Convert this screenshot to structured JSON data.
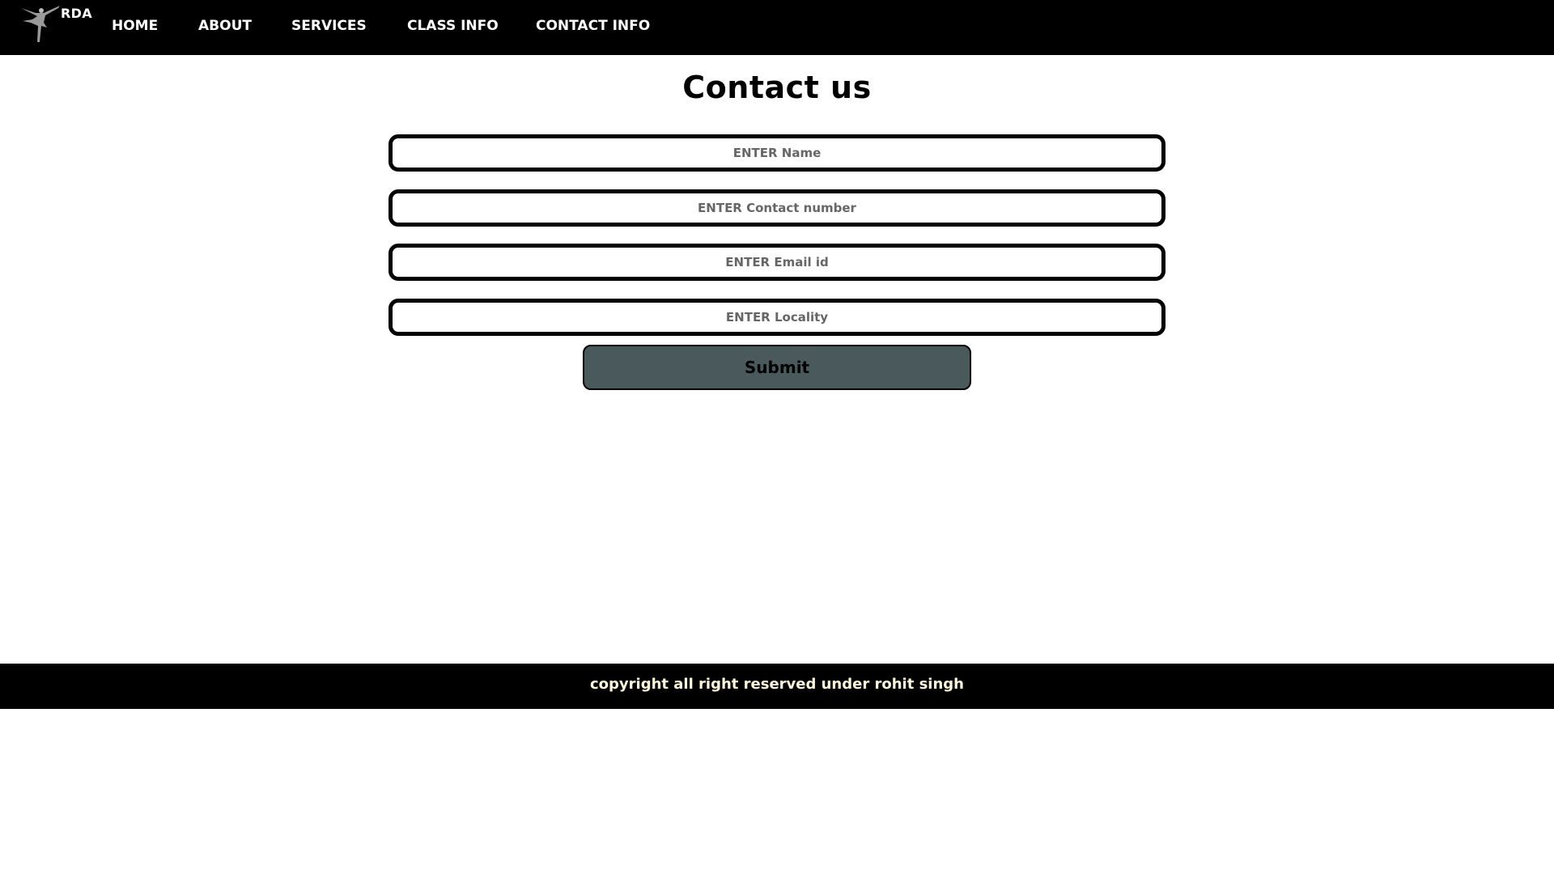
{
  "nav": {
    "brand": "RDA",
    "logo_icon": "ballet-dancer-icon",
    "links": [
      "HOME",
      "ABOUT",
      "SERVICES",
      "CLASS INFO",
      "CONTACT INFO"
    ]
  },
  "main": {
    "title": "Contact us",
    "fields": {
      "name": {
        "placeholder": "ENTER Name",
        "value": ""
      },
      "contact": {
        "placeholder": "ENTER Contact number",
        "value": ""
      },
      "email": {
        "placeholder": "ENTER Email id",
        "value": ""
      },
      "locality": {
        "placeholder": "ENTER Locality",
        "value": ""
      }
    },
    "submit_label": "Submit"
  },
  "footer": {
    "text": "copyright all right reserved under rohit singh"
  },
  "colors": {
    "nav_bg": "#000000",
    "submit_bg": "#4a5a5c",
    "footer_text": "#fff8dc"
  }
}
